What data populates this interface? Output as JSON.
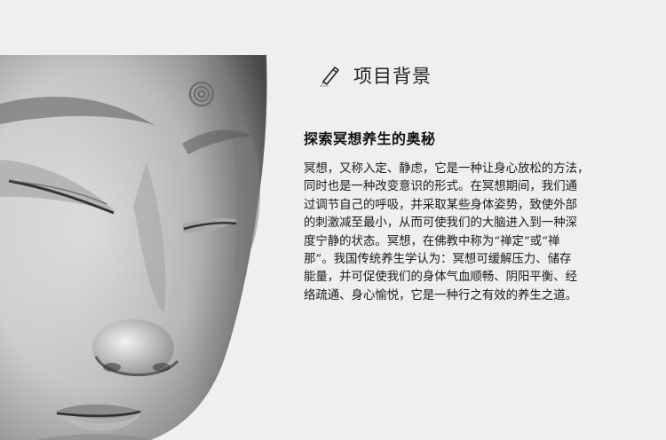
{
  "section": {
    "icon": "pencil-icon",
    "title": "项目背景"
  },
  "article": {
    "heading": "探索冥想养生的奥秘",
    "body": "冥想，又称入定、静虑，它是一种让身心放松的方法，\n同时也是一种改变意识的形式。在冥想期间，我们通\n过调节自己的呼吸，并采取某些身体姿势，致使外部\n的刺激减至最小，从而可使我们的大脑进入到一种深\n度宁静的状态。冥想，在佛教中称为“禅定”或“禅\n那”。我国传统养生学认为：冥想可缓解压力、储存\n能量，并可促使我们的身体气血顺畅、阴阳平衡、经\n络疏通、身心愉悦，它是一种行之有效的养生之道。"
  },
  "illustration": {
    "subject": "buddha-face",
    "palette": [
      "#efefef",
      "#d9d9d9",
      "#a8a8a8",
      "#5e5e5e",
      "#2f2f2f"
    ]
  }
}
